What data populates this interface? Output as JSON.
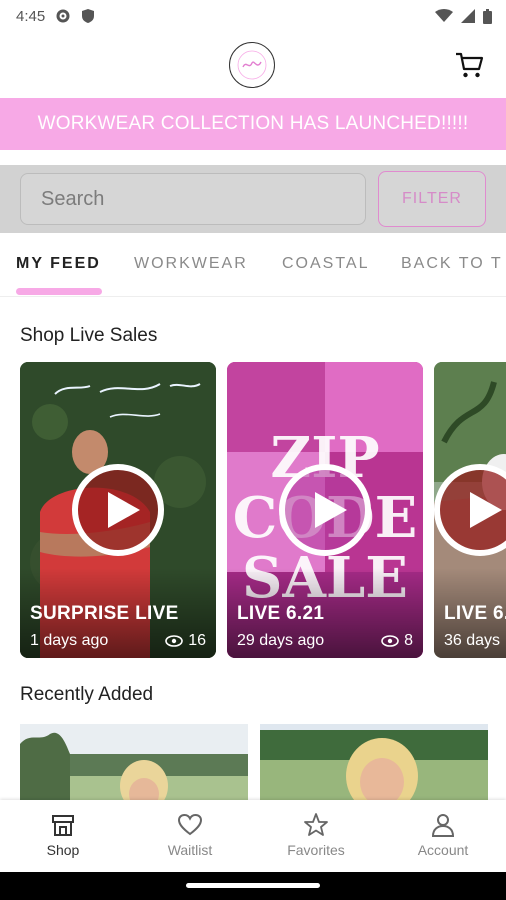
{
  "status_bar": {
    "time": "4:45"
  },
  "header": {
    "logo_alt": "logo",
    "cart_icon": "cart-icon"
  },
  "banner": {
    "text": "WORKWEAR COLLECTION HAS LAUNCHED!!!!!"
  },
  "search": {
    "placeholder": "Search",
    "filter_label": "FILTER"
  },
  "tabs": [
    {
      "label": "MY FEED"
    },
    {
      "label": "WORKWEAR"
    },
    {
      "label": "COASTAL"
    },
    {
      "label": "BACK TO T"
    }
  ],
  "sections": {
    "live_sales": "Shop Live Sales",
    "recently_added": "Recently Added"
  },
  "live_sales": [
    {
      "title": "SURPRISE LIVE",
      "age": "1 days ago",
      "views": "16"
    },
    {
      "title": "LIVE 6.21",
      "age": "29 days ago",
      "views": "8"
    },
    {
      "title": "LIVE 6.",
      "age": "36 days"
    }
  ],
  "bottom_nav": [
    {
      "label": "Shop",
      "icon": "store-icon"
    },
    {
      "label": "Waitlist",
      "icon": "heart-icon"
    },
    {
      "label": "Favorites",
      "icon": "star-icon"
    },
    {
      "label": "Account",
      "icon": "person-icon"
    }
  ],
  "colors": {
    "brand_pink": "#f7a9e6",
    "filter_pink": "#d68bc8"
  }
}
